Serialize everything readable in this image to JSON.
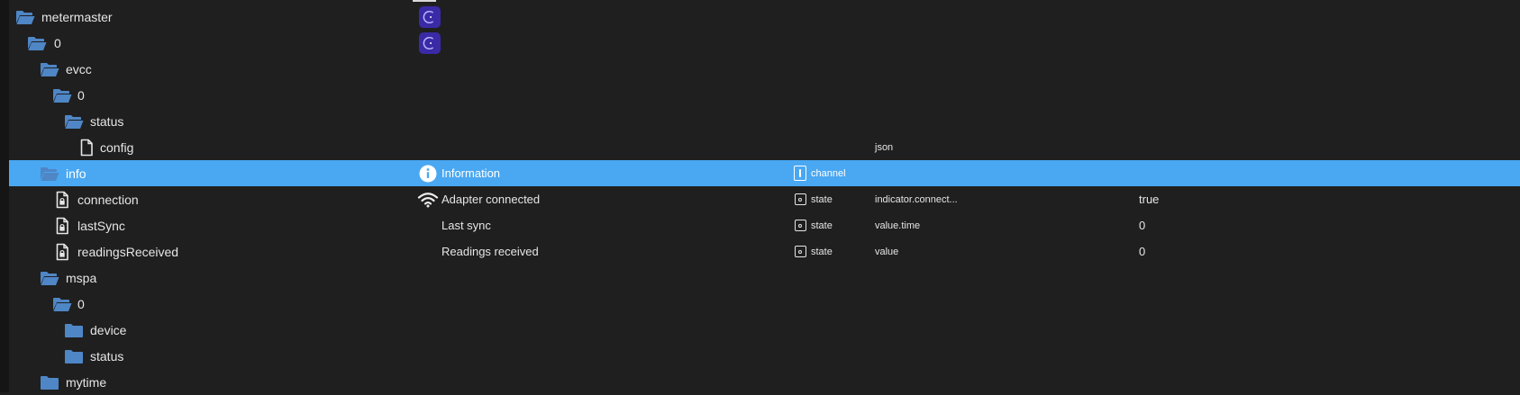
{
  "tree": {
    "rows": {
      "metermaster": {
        "label": "metermaster"
      },
      "mm0": {
        "label": "0"
      },
      "evcc": {
        "label": "evcc"
      },
      "evcc0": {
        "label": "0"
      },
      "evcc_status": {
        "label": "status"
      },
      "config": {
        "label": "config",
        "role": "json"
      },
      "info": {
        "label": "info",
        "name": "Information",
        "type": "channel"
      },
      "connection": {
        "label": "connection",
        "name": "Adapter connected",
        "type": "state",
        "role": "indicator.connect...",
        "value": "true"
      },
      "lastSync": {
        "label": "lastSync",
        "name": "Last sync",
        "type": "state",
        "role": "value.time",
        "value": "0"
      },
      "readingsReceived": {
        "label": "readingsReceived",
        "name": "Readings received",
        "type": "state",
        "role": "value",
        "value": "0"
      },
      "mspa": {
        "label": "mspa"
      },
      "mspa0": {
        "label": "0"
      },
      "device": {
        "label": "device"
      },
      "mspa_status": {
        "label": "status"
      },
      "mytime": {
        "label": "mytime"
      }
    }
  },
  "icons": {
    "folder_open": "folder-open-icon",
    "folder_closed": "folder-icon",
    "file": "file-icon",
    "state_file": "state-file-icon",
    "adapter": "adapter-logo-icon",
    "info": "info-icon",
    "wifi": "wifi-icon",
    "type_state": "state-type-icon",
    "type_channel": "channel-type-icon"
  },
  "colors": {
    "background": "#1f1f1f",
    "selection": "#4aa8f2",
    "folder": "#4f86c6",
    "adapter_badge": "#3a2aa6",
    "text": "#e6e6e6"
  }
}
